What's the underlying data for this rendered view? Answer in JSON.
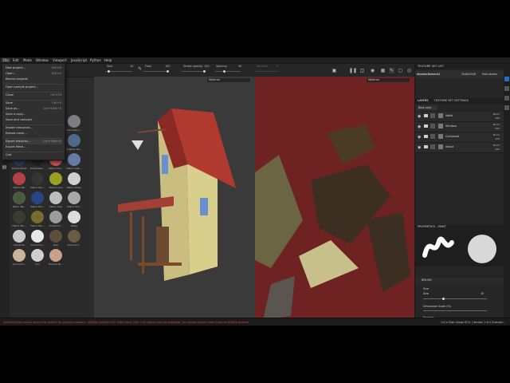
{
  "menubar": [
    "File",
    "Edit",
    "Mode",
    "Window",
    "Viewport",
    "JavaScript",
    "Python",
    "Help"
  ],
  "toolbar": {
    "size_label": "Size",
    "size_value": "10",
    "flow_label": "Flow",
    "flow_value": "100",
    "stroke_opacity_label": "Stroke opacity",
    "stroke_opacity_value": "100",
    "spacing_label": "Spacing",
    "spacing_value": "30",
    "rotation_label": "Rotation",
    "rotation_value": "0"
  },
  "file_menu": [
    {
      "label": "New project...",
      "shortcut": "Ctrl+N"
    },
    {
      "label": "Open...",
      "shortcut": "Ctrl+O"
    },
    {
      "label": "Recent projects",
      "shortcut": ""
    },
    {
      "label": "Open sample project...",
      "shortcut": ""
    },
    {
      "label": "Close",
      "shortcut": "Ctrl+F4"
    },
    {
      "label": "Save",
      "shortcut": "Ctrl+S"
    },
    {
      "label": "Save as...",
      "shortcut": "Ctrl+Shift+S"
    },
    {
      "label": "Save a copy...",
      "shortcut": ""
    },
    {
      "label": "Save and compact",
      "shortcut": ""
    },
    {
      "label": "Import resources...",
      "shortcut": ""
    },
    {
      "label": "Reload mesh...",
      "shortcut": ""
    },
    {
      "label": "Export textures...",
      "shortcut": "Ctrl+Shift+E"
    },
    {
      "label": "Export Mesh...",
      "shortcut": ""
    },
    {
      "label": "Quit",
      "shortcut": ""
    }
  ],
  "shelf_items": [
    {
      "label": "Carbon Fiber",
      "color": "#151515"
    },
    {
      "label": "Concrete",
      "color": "#8c8c86"
    },
    {
      "label": "",
      "color": "#2b2b2b"
    },
    {
      "label": "Concrete C...",
      "color": "#7c7e80"
    },
    {
      "label": "Cork Natural",
      "color": "#a07c52"
    },
    {
      "label": "Custom Sk...",
      "color": "#222222"
    },
    {
      "label": "Custom Sk...",
      "color": "#cf6a64"
    },
    {
      "label": "Custom Sk...",
      "color": "#4f6a8e"
    },
    {
      "label": "Denim Rivet",
      "color": "#2f3a52"
    },
    {
      "label": "Embroider...",
      "color": "#202020"
    },
    {
      "label": "Fabric Cot...",
      "color": "#c45055"
    },
    {
      "label": "Fabric Leat...",
      "color": "#667aa6"
    },
    {
      "label": "Fabric Rib",
      "color": "#b44046"
    },
    {
      "label": "Fabric Vel...",
      "color": "#353535"
    },
    {
      "label": "Fabric Lace",
      "color": "#9aa025"
    },
    {
      "label": "Fabric Linen",
      "color": "#cfcfcf"
    },
    {
      "label": "Fabric Ny...",
      "color": "#4b5a3e"
    },
    {
      "label": "Fabric Pol...",
      "color": "#274580"
    },
    {
      "label": "Fabric Sue",
      "color": "#bcbcbc"
    },
    {
      "label": "Fabric Sof...",
      "color": "#a8a8a8"
    },
    {
      "label": "Fabric Wo...",
      "color": "#3b3b30"
    },
    {
      "label": "Fabric Wo...",
      "color": "#7a6a2e"
    },
    {
      "label": "Footprint...",
      "color": "#9c9c9c"
    },
    {
      "label": "Glass",
      "color": "#dcdcdc"
    },
    {
      "label": "Gouache",
      "color": "#c8c8c8"
    },
    {
      "label": "Ground G...",
      "color": "#e8e8e8"
    },
    {
      "label": "Grip",
      "color": "#5e4e3c"
    },
    {
      "label": "Ground S...",
      "color": "#6a5a46"
    },
    {
      "label": "Ground S...",
      "color": "#c9b39a"
    },
    {
      "label": "Iron",
      "color": "#cfcfcf"
    },
    {
      "label": "Human Fe...",
      "color": "#c8a288"
    }
  ],
  "viewport": {
    "left_mode": "Material",
    "right_mode": "Material"
  },
  "texture_set_list": {
    "title": "TEXTURE SET LIST",
    "set_name": "tdjoadocBarbaral1",
    "resolution": "2048x2048",
    "shader": "Main shader"
  },
  "layers_panel": {
    "tab_layers": "LAYERS",
    "tab_settings": "TEXTURE SET SETTINGS",
    "channel": "Base color"
  },
  "layers": [
    {
      "name": "Walls",
      "blend": "Norm",
      "opacity": "100"
    },
    {
      "name": "Window",
      "blend": "Norm",
      "opacity": "100"
    },
    {
      "name": "Cartwood",
      "blend": "Norm",
      "opacity": "100"
    },
    {
      "name": "Wood",
      "blend": "Norm",
      "opacity": "100"
    }
  ],
  "properties": {
    "title": "PROPERTIES - PAINT",
    "brush_label": "BRUSH",
    "size_label": "Size",
    "size_value": "10",
    "size_space_label": "Size",
    "dimension_label": "Dimension Scale (%)",
    "spacing_label": "Spacing"
  },
  "status": {
    "error": "[Whitelist] No tracker ignore the default for graphics support - NVIDIA GeForce GTX 1660 Super (Win 7 or higher) may be outdated. You should update them from the NVIDIA website. ",
    "memory": "CoCo Disk Usage 82% | Version 2.6.2 Evaluati..."
  },
  "colors": {
    "accent": "#1f6fd0",
    "roof": "#b13a30",
    "wall": "#d8cf8c",
    "error": "#d04848"
  }
}
